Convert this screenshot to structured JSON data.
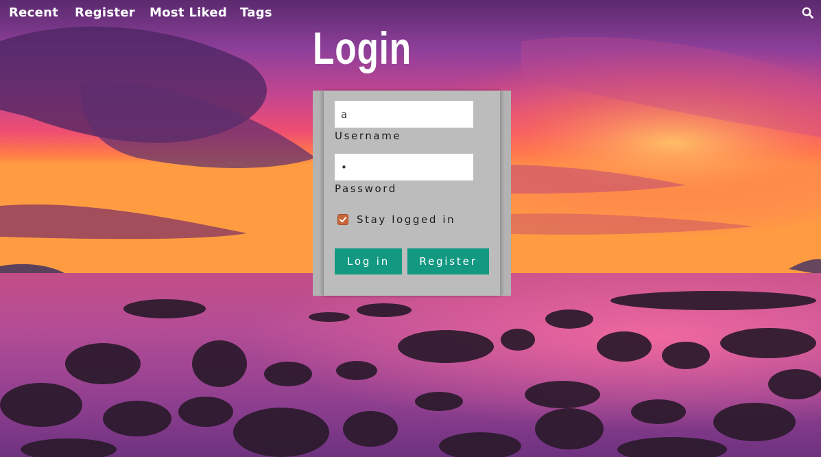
{
  "nav": {
    "links": [
      "Recent",
      "Register",
      "Most Liked",
      "Tags"
    ],
    "search_icon": "search-icon"
  },
  "page": {
    "title": "Login"
  },
  "login_form": {
    "username": {
      "value": "a",
      "label": "Username"
    },
    "password": {
      "value": "•",
      "label": "Password"
    },
    "remember": {
      "checked": true,
      "label": "Stay logged in"
    },
    "buttons": {
      "login": "Log in",
      "register": "Register"
    }
  },
  "colors": {
    "card_background": "#b3b3b3",
    "button_background": "#139882",
    "checkbox_accent": "#c8663a",
    "nav_text": "#ffffff"
  }
}
